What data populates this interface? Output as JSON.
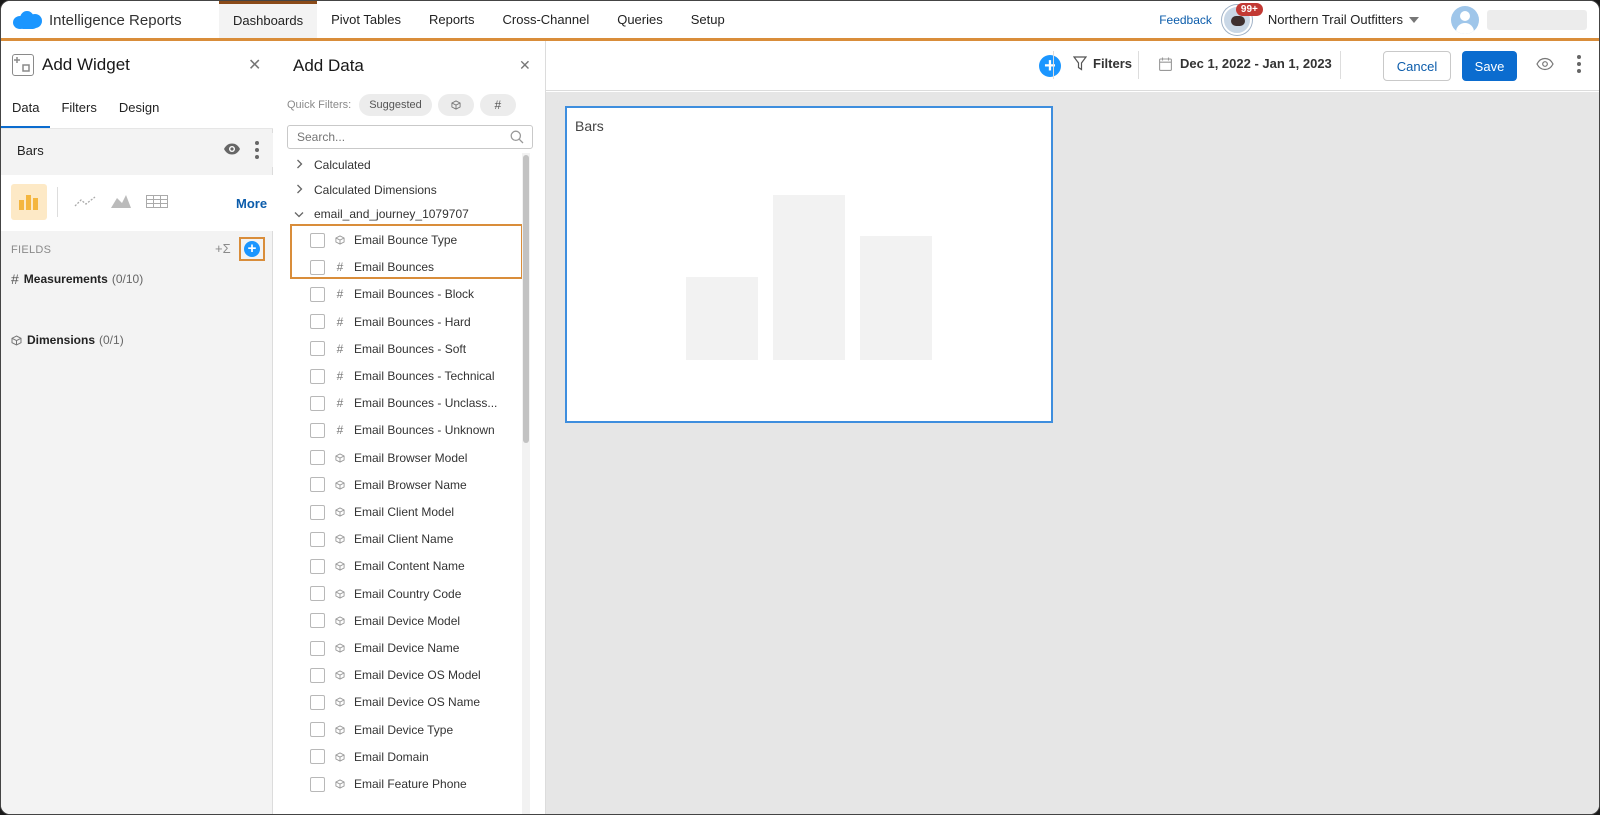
{
  "app": {
    "brand": "Intelligence Reports",
    "nav_tabs": [
      "Dashboards",
      "Pivot Tables",
      "Reports",
      "Cross-Channel",
      "Queries",
      "Setup"
    ],
    "feedback": "Feedback",
    "notifications": "99+",
    "org": "Northern Trail Outfitters"
  },
  "toolbar": {
    "filters": "Filters",
    "date_range": "Dec 1, 2022 - Jan 1, 2023",
    "cancel": "Cancel",
    "save": "Save"
  },
  "add_widget": {
    "title": "Add Widget",
    "tabs": [
      "Data",
      "Filters",
      "Design"
    ],
    "widget_name": "Bars",
    "more": "More",
    "fields_label": "FIELDS",
    "fields_tools": "+Σ",
    "measurements": "Measurements",
    "measurements_count": "(0/10)",
    "dimensions": "Dimensions",
    "dimensions_count": "(0/1)"
  },
  "add_data": {
    "title": "Add Data",
    "quick_filters_label": "Quick Filters:",
    "suggested": "Suggested",
    "search_placeholder": "Search...",
    "groups": [
      "Calculated",
      "Calculated Dimensions",
      "email_and_journey_1079707"
    ],
    "fields": [
      {
        "label": "Email Bounce Type",
        "type": "dimension"
      },
      {
        "label": "Email Bounces",
        "type": "measure"
      },
      {
        "label": "Email Bounces - Block",
        "type": "measure"
      },
      {
        "label": "Email Bounces - Hard",
        "type": "measure"
      },
      {
        "label": "Email Bounces - Soft",
        "type": "measure"
      },
      {
        "label": "Email Bounces - Technical",
        "type": "measure"
      },
      {
        "label": "Email Bounces - Unclass...",
        "type": "measure"
      },
      {
        "label": "Email Bounces - Unknown",
        "type": "measure"
      },
      {
        "label": "Email Browser Model",
        "type": "dimension"
      },
      {
        "label": "Email Browser Name",
        "type": "dimension"
      },
      {
        "label": "Email Client Model",
        "type": "dimension"
      },
      {
        "label": "Email Client Name",
        "type": "dimension"
      },
      {
        "label": "Email Content Name",
        "type": "dimension"
      },
      {
        "label": "Email Country Code",
        "type": "dimension"
      },
      {
        "label": "Email Device Model",
        "type": "dimension"
      },
      {
        "label": "Email Device Name",
        "type": "dimension"
      },
      {
        "label": "Email Device OS Model",
        "type": "dimension"
      },
      {
        "label": "Email Device OS Name",
        "type": "dimension"
      },
      {
        "label": "Email Device Type",
        "type": "dimension"
      },
      {
        "label": "Email Domain",
        "type": "dimension"
      },
      {
        "label": "Email Feature Phone",
        "type": "dimension"
      }
    ]
  },
  "canvas": {
    "widget_title": "Bars"
  },
  "colors": {
    "accent": "#d98d3a",
    "primary": "#0b6ccf",
    "brand_blue": "#1b96ff",
    "bar_placeholder": "#f2f2f2"
  }
}
